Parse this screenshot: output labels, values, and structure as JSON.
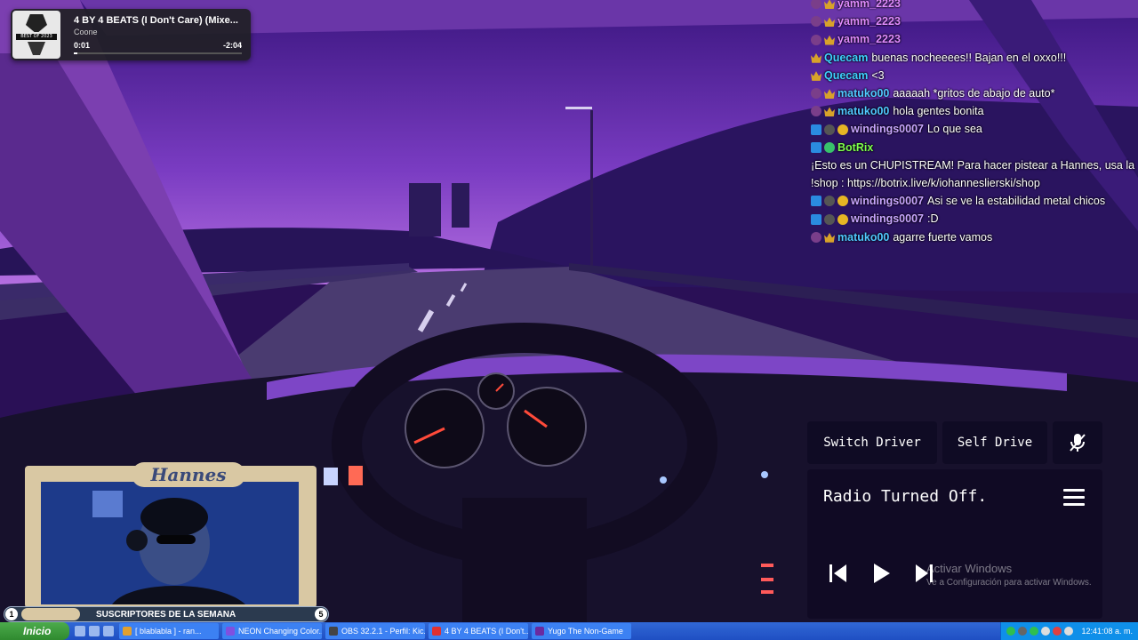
{
  "now_playing": {
    "art_badge": "BEST OF 2023",
    "title": "4 BY 4 BEATS (I Don't Care) (Mixe...",
    "artist": "Coone",
    "elapsed": "0:01",
    "remaining": "-2:04",
    "progress": 0.02
  },
  "chat": [
    {
      "badges": [
        "ogi",
        "sub"
      ],
      "user": "yamm_2223",
      "cls": "u-yamm",
      "text": ""
    },
    {
      "badges": [
        "ogi",
        "sub"
      ],
      "user": "yamm_2223",
      "cls": "u-yamm",
      "text": ""
    },
    {
      "badges": [
        "ogi",
        "sub"
      ],
      "user": "yamm_2223",
      "cls": "u-yamm",
      "text": ""
    },
    {
      "badges": [
        "sub"
      ],
      "user": "Quecam",
      "cls": "u-quecam",
      "text": "buenas nocheeees!! Bajan en el oxxo!!!"
    },
    {
      "badges": [
        "sub"
      ],
      "user": "Quecam",
      "cls": "u-quecam",
      "text": "<3"
    },
    {
      "badges": [
        "ogi",
        "sub"
      ],
      "user": "matuko00",
      "cls": "u-matuko",
      "text": "aaaaah *gritos de abajo de auto*"
    },
    {
      "badges": [
        "ogi",
        "sub"
      ],
      "user": "matuko00",
      "cls": "u-matuko",
      "text": "hola gentes bonita"
    },
    {
      "badges": [
        "arrow",
        "mod",
        "coin"
      ],
      "user": "windings0007",
      "cls": "u-windings",
      "text": "Lo que sea"
    },
    {
      "badges": [
        "arrow",
        "bot"
      ],
      "user": "BotRix",
      "cls": "u-botrix",
      "text": "¡Esto es un CHUPISTREAM! Para hacer pistear a Hannes, usa la !shop : https://botrix.live/k/iohanneslierski/shop"
    },
    {
      "badges": [
        "arrow",
        "mod",
        "coin"
      ],
      "user": "windings0007",
      "cls": "u-windings",
      "text": "Asi se ve la estabilidad metal chicos"
    },
    {
      "badges": [
        "arrow",
        "mod",
        "coin"
      ],
      "user": "windings0007",
      "cls": "u-windings",
      "text": ":D"
    },
    {
      "badges": [
        "ogi",
        "sub"
      ],
      "user": "matuko00",
      "cls": "u-matuko",
      "text": "agarre fuerte vamos"
    }
  ],
  "controls": {
    "switch_driver": "Switch Driver",
    "self_drive": "Self Drive"
  },
  "radio": {
    "status": "Radio Turned Off."
  },
  "activation": {
    "line1": "Activar Windows",
    "line2": "Ve a Configuración para activar Windows."
  },
  "webcam": {
    "name": "Hannes"
  },
  "subs_bar": {
    "left_num": "1",
    "label": "SUSCRIPTORES DE LA SEMANA",
    "count": "5"
  },
  "taskbar": {
    "start": "Inicio",
    "tasks": [
      {
        "label": "[ blablabla ] - ran...",
        "color": "#e0a030"
      },
      {
        "label": "NEON Changing Color...",
        "color": "#8050e0"
      },
      {
        "label": "OBS 32.2.1 - Perfil: Kic...",
        "color": "#444444"
      },
      {
        "label": "4 BY 4 BEATS (I Don't...",
        "color": "#e03030"
      },
      {
        "label": "Yugo The Non-Game",
        "color": "#6a2aa0"
      }
    ],
    "clock": "12:41:08 a. m."
  },
  "colors": {
    "sky_top": "#3d1785",
    "sky_horizon": "#a45ad6",
    "road": "#3f3161",
    "dash": "#16102b"
  }
}
